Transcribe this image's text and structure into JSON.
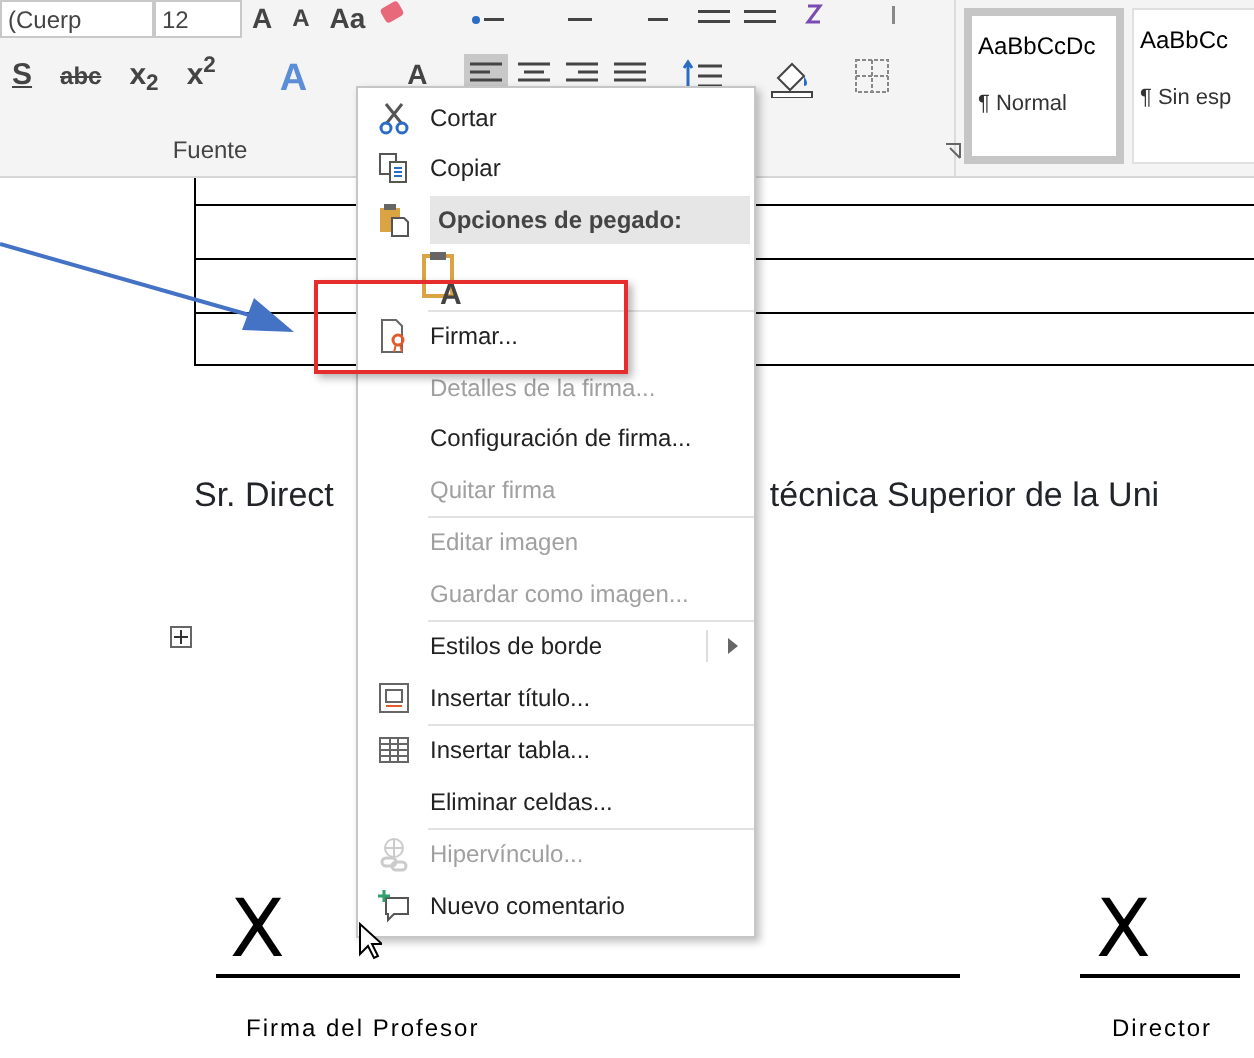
{
  "ribbon": {
    "font_name": "(Cuerp",
    "font_size": "12",
    "size_buttons": [
      "A",
      "A",
      "Aa"
    ],
    "format_buttons": [
      {
        "label": "S",
        "kind": "underline"
      },
      {
        "label": "abc",
        "kind": "strike"
      },
      {
        "label": "x$_{2}$",
        "kind": "script"
      },
      {
        "label": "x$^{2}$",
        "kind": "script"
      },
      {
        "label": "A",
        "kind": "effects"
      },
      {
        "label": "A",
        "kind": "color"
      }
    ],
    "alignment": [
      {
        "selected": true
      },
      {
        "selected": false
      },
      {
        "selected": false
      },
      {
        "selected": false
      }
    ],
    "group_label": "Fuente",
    "styles": [
      {
        "preview": "AaBbCcDc",
        "name": "¶ Normal",
        "selected": true
      },
      {
        "preview": "AaBbCc",
        "name": "¶ Sin esp",
        "selected": false
      }
    ]
  },
  "document": {
    "line_parts": [
      "Sr. Direct",
      "técnica Superior de la Uni"
    ],
    "signatures": [
      {
        "mark": "X",
        "caption": "Firma del Profesor"
      },
      {
        "mark": "X",
        "caption": "Director"
      }
    ]
  },
  "context_menu": {
    "groups": [
      {
        "items": [
          {
            "kind": "scissors",
            "label": "Cortar",
            "disabled": false
          },
          {
            "kind": "copy",
            "label": "Copiar",
            "disabled": false
          },
          {
            "kind": "header",
            "label": "Opciones de pegado:"
          },
          {
            "kind": "paste",
            "label": "A"
          }
        ]
      },
      {
        "items": [
          {
            "kind": "signature",
            "label": "Firmar...",
            "disabled": false
          },
          {
            "kind": "plain",
            "label": "Detalles de la firma...",
            "disabled": true
          },
          {
            "kind": "plain",
            "label": "Configuración de firma...",
            "disabled": false
          },
          {
            "kind": "plain",
            "label": "Quitar firma",
            "disabled": true
          }
        ]
      },
      {
        "items": [
          {
            "kind": "plain",
            "label": "Editar imagen",
            "disabled": true
          },
          {
            "kind": "plain",
            "label": "Guardar como imagen...",
            "disabled": true
          }
        ]
      },
      {
        "items": [
          {
            "kind": "submenu",
            "label": "Estilos de borde",
            "disabled": false
          },
          {
            "kind": "caption",
            "label": "Insertar título...",
            "disabled": false
          }
        ]
      },
      {
        "items": [
          {
            "kind": "table",
            "label": "Insertar tabla...",
            "disabled": false
          },
          {
            "kind": "plain",
            "label": "Eliminar celdas...",
            "disabled": false
          }
        ]
      },
      {
        "items": [
          {
            "kind": "link",
            "label": "Hipervínculo...",
            "disabled": true
          },
          {
            "kind": "comment",
            "label": "Nuevo comentario",
            "disabled": false
          }
        ]
      }
    ]
  }
}
